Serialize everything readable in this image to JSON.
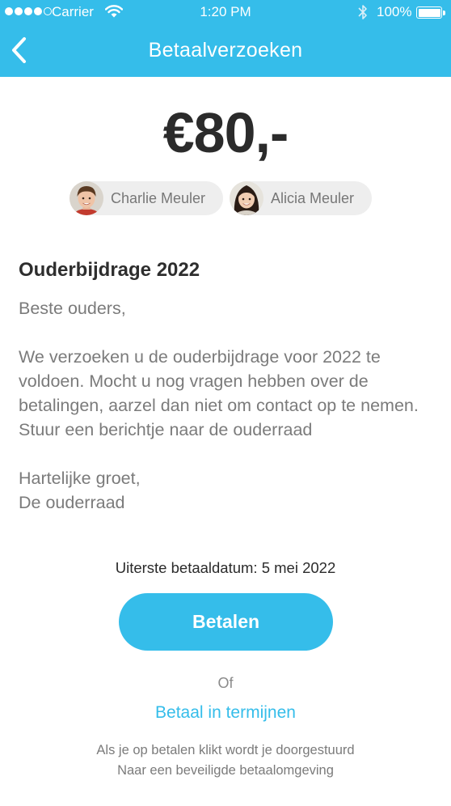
{
  "status_bar": {
    "carrier": "Carrier",
    "time": "1:20 PM",
    "battery": "100%",
    "signal_bars_filled": 4,
    "signal_bars_total": 5,
    "battery_level": 1.0
  },
  "nav": {
    "title": "Betaalverzoeken",
    "back_icon": "chevron-left-icon"
  },
  "amount": "€80,-",
  "children": [
    {
      "name": "Charlie Meuler",
      "avatar": "boy-avatar"
    },
    {
      "name": "Alicia Meuler",
      "avatar": "girl-avatar"
    }
  ],
  "message": {
    "title": "Ouderbijdrage 2022",
    "greeting": "Beste ouders,",
    "body": "We verzoeken u de ouderbijdrage voor 2022 te voldoen. Mocht u nog vragen hebben over de betalingen, aarzel dan niet om contact op te nemen. Stuur een berichtje naar de ouderraad",
    "closing": "Hartelijke groet,",
    "signature": "De ouderraad"
  },
  "deadline": "Uiterste betaaldatum: 5 mei 2022",
  "pay_button": "Betalen",
  "or_text": "Of",
  "installments_link": "Betaal in termijnen",
  "footer": {
    "line1": "Als je op betalen klikt wordt je doorgestuurd",
    "line2": "Naar een beveiligde betaalomgeving"
  },
  "colors": {
    "accent": "#35bdea",
    "text_dark": "#2b2b2b",
    "text_muted": "#7b7b7b",
    "chip_bg": "#eeeeee"
  }
}
